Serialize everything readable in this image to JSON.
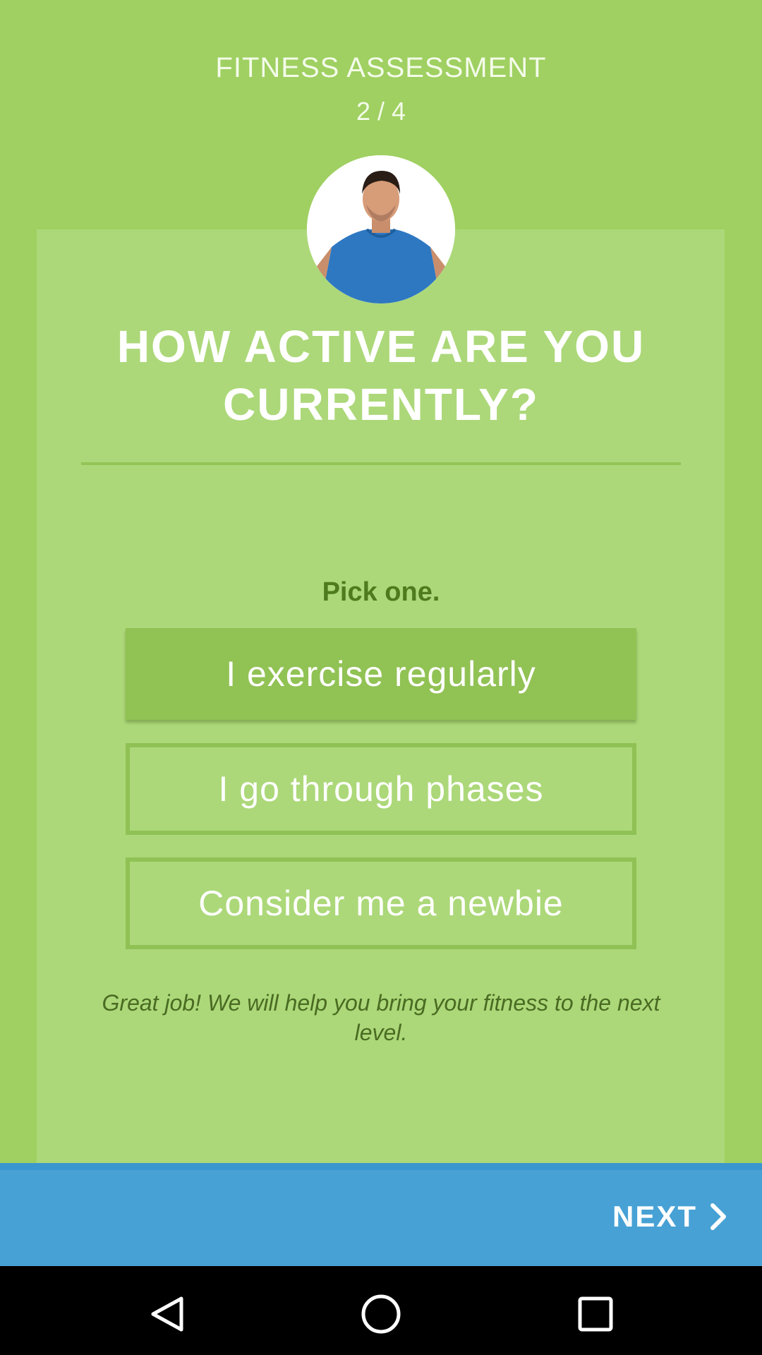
{
  "header": {
    "title": "FITNESS ASSESSMENT",
    "step": "2 / 4",
    "step_current": 2,
    "step_total": 4
  },
  "question": {
    "line1": "HOW ACTIVE ARE YOU",
    "line2": "CURRENTLY?"
  },
  "pick_label": "Pick one.",
  "options": [
    {
      "label": "I exercise regularly",
      "selected": true
    },
    {
      "label": "I go through phases",
      "selected": false
    },
    {
      "label": "Consider me a newbie",
      "selected": false
    }
  ],
  "feedback": "Great job! We will help you bring your fitness to the next level.",
  "footer": {
    "next_label": "NEXT",
    "next_icon": "chevron-right-icon"
  },
  "navbar": {
    "icons": [
      "back-triangle-icon",
      "home-circle-icon",
      "recents-square-icon"
    ]
  },
  "colors": {
    "background": "#9fd061",
    "card": "#acd879",
    "selected_option": "#91c254",
    "option_border": "#8fc155",
    "footer": "#47a1d5",
    "label_dark_green": "#4e7b1d"
  }
}
